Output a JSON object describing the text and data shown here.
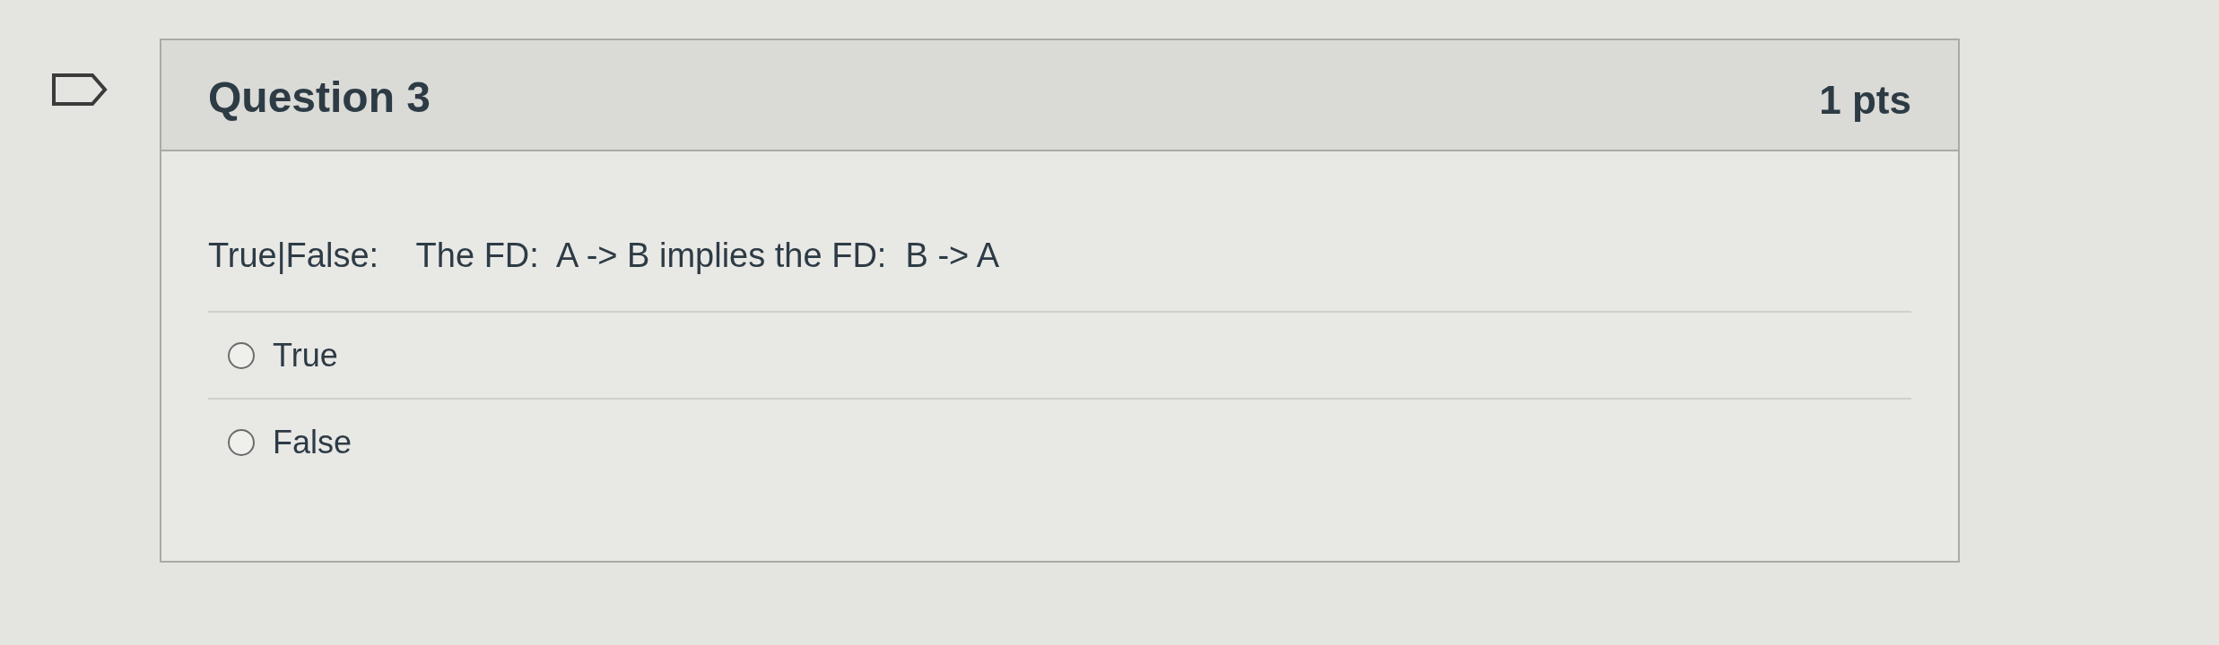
{
  "question": {
    "title": "Question 3",
    "points": "1 pts",
    "flagged": false,
    "prompt": "True|False:    The FD:  A -> B implies the FD:  B -> A",
    "options": [
      {
        "label": "True",
        "selected": false
      },
      {
        "label": "False",
        "selected": false
      }
    ]
  }
}
